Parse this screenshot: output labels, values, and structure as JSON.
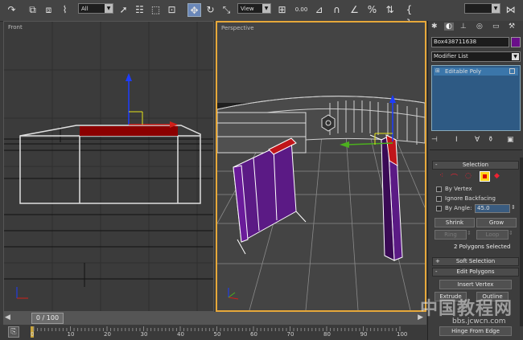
{
  "toolbar": {
    "selection_filter": "All",
    "ref_coord": "View",
    "snap_value": "0.00"
  },
  "viewports": {
    "front_label": "Front",
    "perspective_label": "Perspective"
  },
  "timeline": {
    "frame_counter": "0 / 100",
    "ticks": [
      "0",
      "10",
      "20",
      "30",
      "40",
      "50",
      "60",
      "70",
      "80",
      "90",
      "100"
    ]
  },
  "panel": {
    "object_name": "Box438711638",
    "object_color": "#6a0f8a",
    "modifier_list_label": "Modifier List",
    "stack_item": "Editable Poly",
    "selection_rollout": "Selection",
    "by_vertex": "By Vertex",
    "ignore_backfacing": "Ignore Backfacing",
    "by_angle": "By Angle:",
    "angle_value": "45.0",
    "shrink": "Shrink",
    "grow": "Grow",
    "ring": "Ring",
    "loop": "Loop",
    "selection_status": "2 Polygons Selected",
    "soft_selection_rollout": "Soft Selection",
    "edit_polygons_rollout": "Edit Polygons",
    "insert_vertex": "Insert Vertex",
    "extrude": "Extrude",
    "outline": "Outline",
    "hinge_from_edge": "Hinge From Edge"
  },
  "watermark": {
    "text": "中国教程网",
    "url": "bbs.jcwcn.com"
  },
  "colors": {
    "accent_active_viewport": "#e6a83a",
    "selected_polygon": "#8b0000",
    "object_purple": "#6a1b9a"
  }
}
